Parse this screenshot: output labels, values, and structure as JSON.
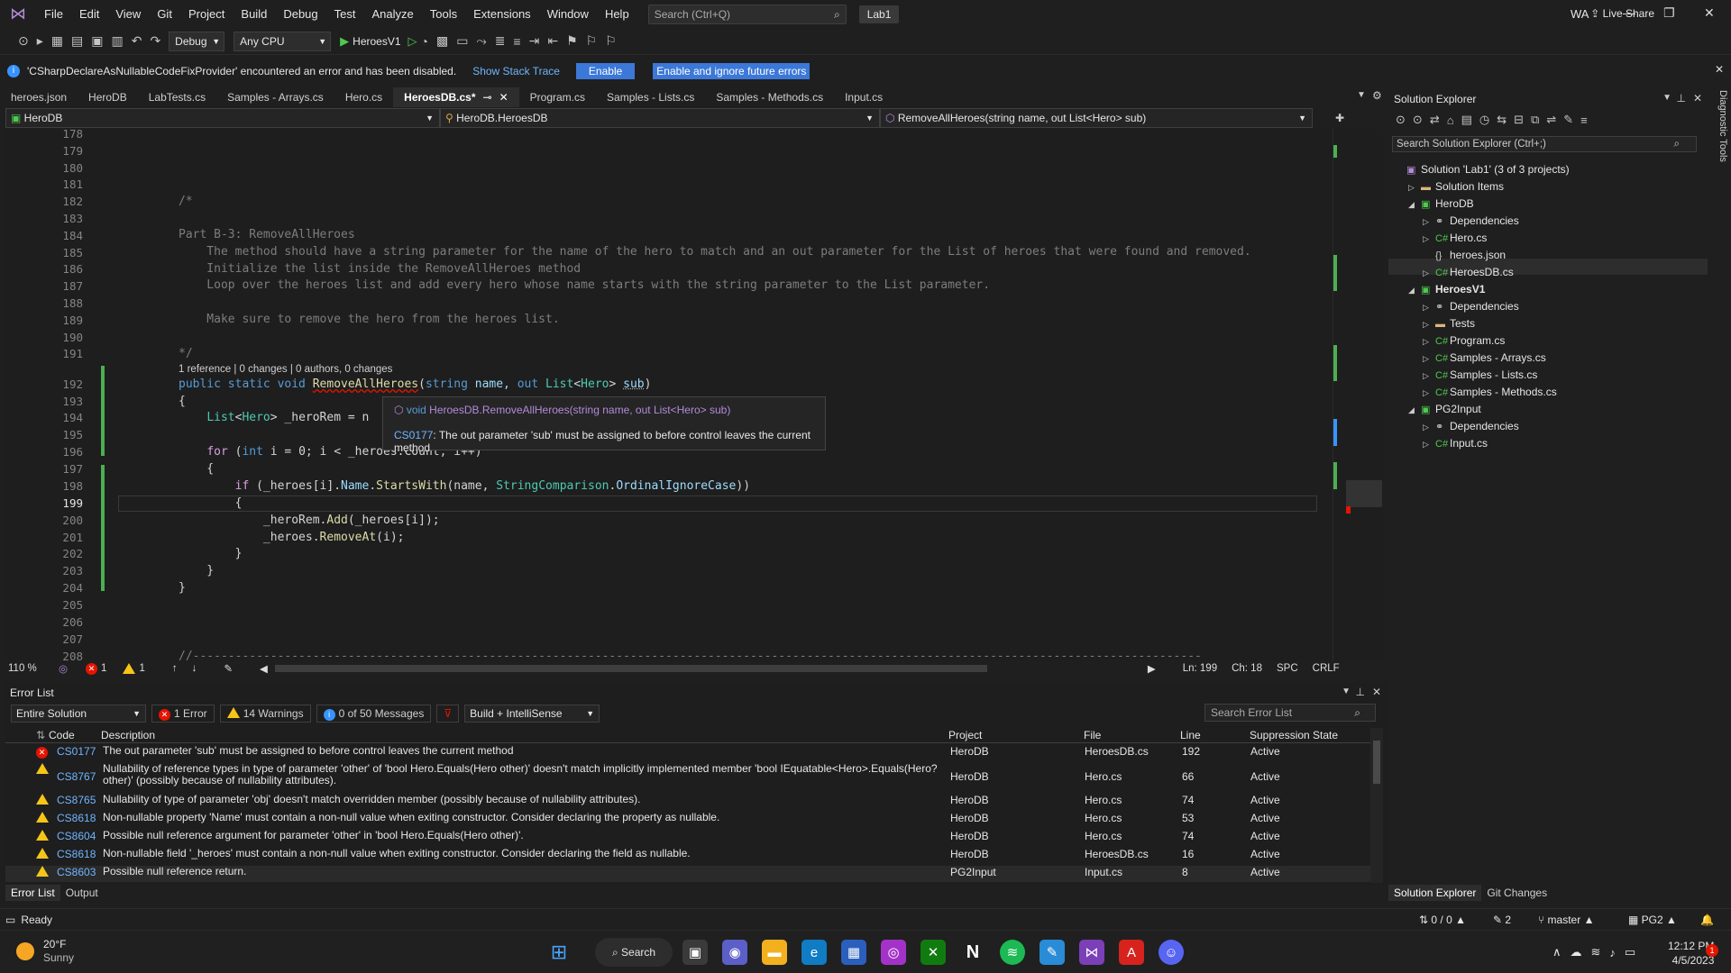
{
  "menubar": {
    "items": [
      "File",
      "Edit",
      "View",
      "Git",
      "Project",
      "Build",
      "Debug",
      "Test",
      "Analyze",
      "Tools",
      "Extensions",
      "Window",
      "Help"
    ],
    "search_placeholder": "Search (Ctrl+Q)",
    "solution_badge": "Lab1",
    "user_initials": "WA"
  },
  "toolbar": {
    "config": "Debug",
    "platform": "Any CPU",
    "startup": "HeroesV1",
    "live_share": "Live Share"
  },
  "infobar": {
    "message": "'CSharpDeclareAsNullableCodeFixProvider' encountered an error and has been disabled.",
    "show_stack": "Show Stack Trace",
    "enable": "Enable",
    "enable_ignore": "Enable and ignore future errors"
  },
  "tabs": [
    {
      "label": "heroes.json",
      "active": false
    },
    {
      "label": "HeroDB",
      "active": false
    },
    {
      "label": "LabTests.cs",
      "active": false
    },
    {
      "label": "Samples - Arrays.cs",
      "active": false
    },
    {
      "label": "Hero.cs",
      "active": false
    },
    {
      "label": "HeroesDB.cs*",
      "active": true
    },
    {
      "label": "Program.cs",
      "active": false
    },
    {
      "label": "Samples - Lists.cs",
      "active": false
    },
    {
      "label": "Samples - Methods.cs",
      "active": false
    },
    {
      "label": "Input.cs",
      "active": false
    }
  ],
  "navbar": {
    "project": "HeroDB",
    "class": "HeroDB.HeroesDB",
    "member": "RemoveAllHeroes(string name, out List<Hero> sub)"
  },
  "editor": {
    "lines": [
      "178",
      "179",
      "180",
      "181",
      "182",
      "183",
      "184",
      "185",
      "186",
      "187",
      "188",
      "189",
      "190",
      "191",
      "192",
      "193",
      "194",
      "195",
      "196",
      "197",
      "198",
      "199",
      "200",
      "201",
      "202",
      "203",
      "204",
      "205",
      "206",
      "207",
      "208"
    ],
    "current_line": "199",
    "comment_open": "/*",
    "part_title": "Part B-3: RemoveAllHeroes",
    "c1": "    The method should have a string parameter for the name of the hero to match and an out parameter for the List of heroes that were found and removed.",
    "c2": "    Initialize the list inside the RemoveAllHeroes method",
    "c3": "    Loop over the heroes list and add every hero whose name starts with the string parameter to the List parameter.",
    "c4": "    Make sure to remove the hero from the heroes list.",
    "comment_close": "*/",
    "codelens": "1 reference | 0 changes | 0 authors, 0 changes",
    "sig_kw1": "public static void ",
    "sig_fn": "RemoveAllHeroes",
    "sig_p1": "(",
    "sig_kw2": "string",
    "sig_p2": " name, ",
    "sig_kw3": "out",
    "sig_p3": " ",
    "sig_ty": "List",
    "sig_p4": "<",
    "sig_ty2": "Hero",
    "sig_p5": "> ",
    "sig_sub": "sub",
    "sig_p6": ")",
    "brace_open": "{",
    "l194a": "    ",
    "l194_ty": "List",
    "l194b": "<",
    "l194_ty2": "Hero",
    "l194c": "> _heroRem = n",
    "l196a": "    ",
    "l196_kw": "for",
    "l196b": " (",
    "l196_kw2": "int",
    "l196c": " i = 0; i < _heroes.Count; i++)",
    "l197": "    {",
    "l198a": "        ",
    "l198_kw": "if",
    "l198b": " (_heroes[i].",
    "l198_pr": "Name",
    "l198c": ".",
    "l198_fn": "StartsWith",
    "l198d": "(name, ",
    "l198_ty": "StringComparison",
    "l198e": ".",
    "l198_pr2": "OrdinalIgnoreCase",
    "l198f": "))",
    "l199": "        {",
    "l200a": "            _heroRem.",
    "l200_fn": "Add",
    "l200b": "(_heroes[i]);",
    "l201a": "            _heroes.",
    "l201_fn": "RemoveAt",
    "l201b": "(i);",
    "l202": "        }",
    "l203": "    }",
    "l204": "}",
    "l208": "//-----------------------------------------------------------------------------------------------------------------------------------------------"
  },
  "tooltip": {
    "sig_kw": "void ",
    "sig_rest": "HeroesDB.RemoveAllHeroes(string name, out List<Hero> sub)",
    "err_code": "CS0177",
    "err_msg": ": The out parameter 'sub' must be assigned to before control leaves the current method"
  },
  "edstatus": {
    "zoom": "110 %",
    "errors": "1",
    "warnings": "1",
    "ln": "Ln: 199",
    "ch": "Ch: 18",
    "spc": "SPC",
    "crlf": "CRLF"
  },
  "errorlist": {
    "title": "Error List",
    "scope": "Entire Solution",
    "errors_btn": "1 Error",
    "warnings_btn": "14 Warnings",
    "messages_btn": "0 of 50 Messages",
    "build_filter": "Build + IntelliSense",
    "search_placeholder": "Search Error List",
    "headers": {
      "code": "Code",
      "description": "Description",
      "project": "Project",
      "file": "File",
      "line": "Line",
      "suppression": "Suppression State"
    },
    "rows": [
      {
        "type": "error",
        "code": "CS0177",
        "description": "The out parameter 'sub' must be assigned to before control leaves the current method",
        "project": "HeroDB",
        "file": "HeroesDB.cs",
        "line": "192",
        "state": "Active"
      },
      {
        "type": "warning",
        "code": "CS8767",
        "description": "Nullability of reference types in type of parameter 'other' of 'bool Hero.Equals(Hero other)' doesn't match implicitly implemented member 'bool IEquatable<Hero>.Equals(Hero? other)' (possibly because of nullability attributes).",
        "project": "HeroDB",
        "file": "Hero.cs",
        "line": "66",
        "state": "Active"
      },
      {
        "type": "warning",
        "code": "CS8765",
        "description": "Nullability of type of parameter 'obj' doesn't match overridden member (possibly because of nullability attributes).",
        "project": "HeroDB",
        "file": "Hero.cs",
        "line": "74",
        "state": "Active"
      },
      {
        "type": "warning",
        "code": "CS8618",
        "description": "Non-nullable property 'Name' must contain a non-null value when exiting constructor. Consider declaring the property as nullable.",
        "project": "HeroDB",
        "file": "Hero.cs",
        "line": "53",
        "state": "Active"
      },
      {
        "type": "warning",
        "code": "CS8604",
        "description": "Possible null reference argument for parameter 'other' in 'bool Hero.Equals(Hero other)'.",
        "project": "HeroDB",
        "file": "Hero.cs",
        "line": "74",
        "state": "Active"
      },
      {
        "type": "warning",
        "code": "CS8618",
        "description": "Non-nullable field '_heroes' must contain a non-null value when exiting constructor. Consider declaring the field as nullable.",
        "project": "HeroDB",
        "file": "HeroesDB.cs",
        "line": "16",
        "state": "Active"
      },
      {
        "type": "warning",
        "code": "CS8603",
        "description": "Possible null reference return.",
        "project": "PG2Input",
        "file": "Input.cs",
        "line": "8",
        "state": "Active"
      }
    ],
    "bottom_tabs": [
      "Error List",
      "Output"
    ]
  },
  "solution_explorer": {
    "title": "Solution Explorer",
    "search_placeholder": "Search Solution Explorer (Ctrl+;)",
    "nodes": [
      {
        "label": "Solution 'Lab1' (3 of 3 projects)",
        "indent": 0,
        "exp": "",
        "icon": "sln"
      },
      {
        "label": "Solution Items",
        "indent": 1,
        "exp": "▷",
        "icon": "folder"
      },
      {
        "label": "HeroDB",
        "indent": 1,
        "exp": "◢",
        "icon": "proj"
      },
      {
        "label": "Dependencies",
        "indent": 2,
        "exp": "▷",
        "icon": "dep"
      },
      {
        "label": "Hero.cs",
        "indent": 2,
        "exp": "▷",
        "icon": "cs"
      },
      {
        "label": "heroes.json",
        "indent": 2,
        "exp": "",
        "icon": "json"
      },
      {
        "label": "HeroesDB.cs",
        "indent": 2,
        "exp": "▷",
        "icon": "cs"
      },
      {
        "label": "HeroesV1",
        "indent": 1,
        "exp": "◢",
        "icon": "proj"
      },
      {
        "label": "Dependencies",
        "indent": 2,
        "exp": "▷",
        "icon": "dep"
      },
      {
        "label": "Tests",
        "indent": 2,
        "exp": "▷",
        "icon": "folder"
      },
      {
        "label": "Program.cs",
        "indent": 2,
        "exp": "▷",
        "icon": "cs"
      },
      {
        "label": "Samples - Arrays.cs",
        "indent": 2,
        "exp": "▷",
        "icon": "cs"
      },
      {
        "label": "Samples - Lists.cs",
        "indent": 2,
        "exp": "▷",
        "icon": "cs"
      },
      {
        "label": "Samples - Methods.cs",
        "indent": 2,
        "exp": "▷",
        "icon": "cs"
      },
      {
        "label": "PG2Input",
        "indent": 1,
        "exp": "◢",
        "icon": "proj"
      },
      {
        "label": "Dependencies",
        "indent": 2,
        "exp": "▷",
        "icon": "dep"
      },
      {
        "label": "Input.cs",
        "indent": 2,
        "exp": "▷",
        "icon": "cs"
      }
    ],
    "bottom_tabs": [
      "Solution Explorer",
      "Git Changes"
    ],
    "diag_tools": "Diagnostic Tools"
  },
  "statusbar": {
    "ready": "Ready",
    "sync": "0 / 0",
    "pencil": "2",
    "branch": "master",
    "repo": "PG2"
  },
  "taskbar": {
    "temp": "20°F",
    "weather": "Sunny",
    "search": "Search",
    "time": "12:12 PM",
    "date": "4/5/2023"
  },
  "colors": {
    "accent": "#3b78d8",
    "error": "#e51400",
    "warning": "#f5c518",
    "link": "#6fb5ff"
  }
}
